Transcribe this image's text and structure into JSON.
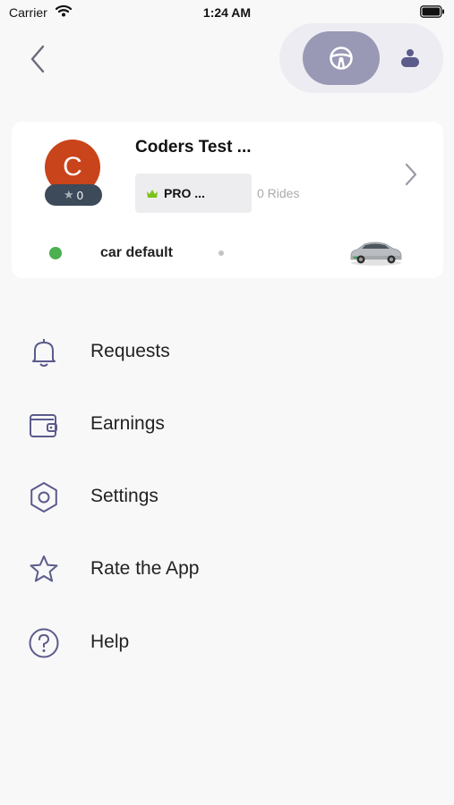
{
  "status_bar": {
    "carrier": "Carrier",
    "time": "1:24 AM"
  },
  "header": {
    "back_icon": "chevron-left-icon",
    "mode_toggle": {
      "selected": "driver",
      "driver_icon": "steering-wheel-icon",
      "rider_icon": "person-icon",
      "active_color": "#9999b6"
    }
  },
  "profile": {
    "avatar_initial": "C",
    "avatar_color": "#c9441a",
    "rating": "0",
    "name": "Coders Test ...",
    "plan": "PRO ...",
    "plan_icon": "crown-icon",
    "rides": "0 Rides",
    "car": {
      "status_color": "#4caf50",
      "name": "car default"
    }
  },
  "menu": {
    "items": [
      {
        "label": "Requests",
        "icon": "bell-icon"
      },
      {
        "label": "Earnings",
        "icon": "wallet-icon"
      },
      {
        "label": "Settings",
        "icon": "hexagon-settings-icon"
      },
      {
        "label": "Rate the App",
        "icon": "star-icon"
      },
      {
        "label": "Help",
        "icon": "question-circle-icon"
      }
    ]
  },
  "colors": {
    "icon_stroke": "#5b5b8c",
    "background": "#f8f8f9"
  }
}
